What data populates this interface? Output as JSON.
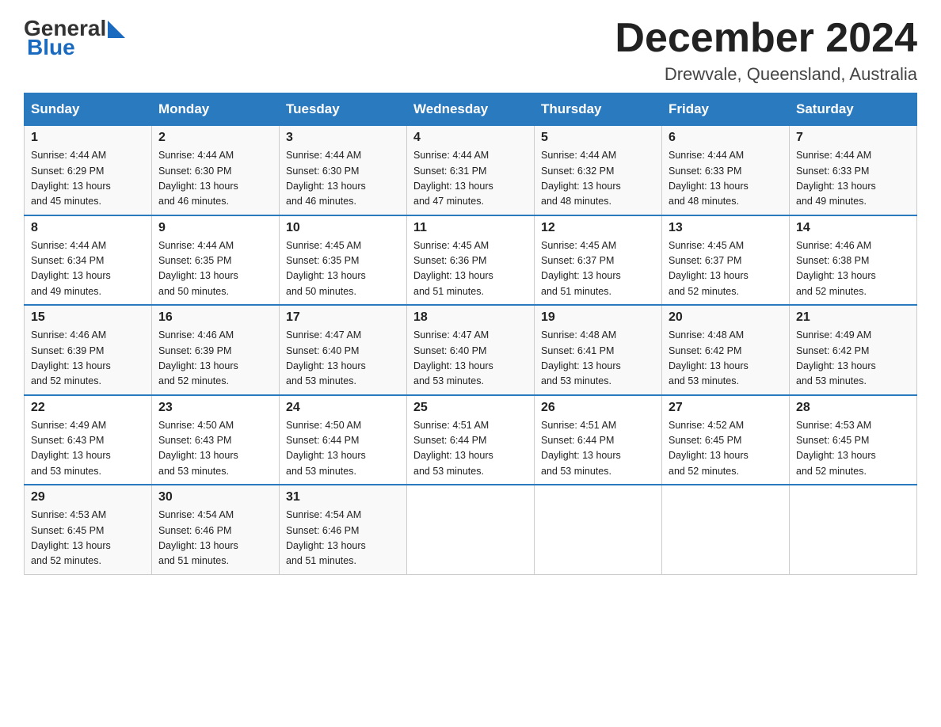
{
  "header": {
    "logo_general": "General",
    "logo_blue": "Blue",
    "month_title": "December 2024",
    "location": "Drewvale, Queensland, Australia"
  },
  "weekdays": [
    "Sunday",
    "Monday",
    "Tuesday",
    "Wednesday",
    "Thursday",
    "Friday",
    "Saturday"
  ],
  "weeks": [
    [
      {
        "day": "1",
        "sunrise": "4:44 AM",
        "sunset": "6:29 PM",
        "daylight": "13 hours and 45 minutes."
      },
      {
        "day": "2",
        "sunrise": "4:44 AM",
        "sunset": "6:30 PM",
        "daylight": "13 hours and 46 minutes."
      },
      {
        "day": "3",
        "sunrise": "4:44 AM",
        "sunset": "6:30 PM",
        "daylight": "13 hours and 46 minutes."
      },
      {
        "day": "4",
        "sunrise": "4:44 AM",
        "sunset": "6:31 PM",
        "daylight": "13 hours and 47 minutes."
      },
      {
        "day": "5",
        "sunrise": "4:44 AM",
        "sunset": "6:32 PM",
        "daylight": "13 hours and 48 minutes."
      },
      {
        "day": "6",
        "sunrise": "4:44 AM",
        "sunset": "6:33 PM",
        "daylight": "13 hours and 48 minutes."
      },
      {
        "day": "7",
        "sunrise": "4:44 AM",
        "sunset": "6:33 PM",
        "daylight": "13 hours and 49 minutes."
      }
    ],
    [
      {
        "day": "8",
        "sunrise": "4:44 AM",
        "sunset": "6:34 PM",
        "daylight": "13 hours and 49 minutes."
      },
      {
        "day": "9",
        "sunrise": "4:44 AM",
        "sunset": "6:35 PM",
        "daylight": "13 hours and 50 minutes."
      },
      {
        "day": "10",
        "sunrise": "4:45 AM",
        "sunset": "6:35 PM",
        "daylight": "13 hours and 50 minutes."
      },
      {
        "day": "11",
        "sunrise": "4:45 AM",
        "sunset": "6:36 PM",
        "daylight": "13 hours and 51 minutes."
      },
      {
        "day": "12",
        "sunrise": "4:45 AM",
        "sunset": "6:37 PM",
        "daylight": "13 hours and 51 minutes."
      },
      {
        "day": "13",
        "sunrise": "4:45 AM",
        "sunset": "6:37 PM",
        "daylight": "13 hours and 52 minutes."
      },
      {
        "day": "14",
        "sunrise": "4:46 AM",
        "sunset": "6:38 PM",
        "daylight": "13 hours and 52 minutes."
      }
    ],
    [
      {
        "day": "15",
        "sunrise": "4:46 AM",
        "sunset": "6:39 PM",
        "daylight": "13 hours and 52 minutes."
      },
      {
        "day": "16",
        "sunrise": "4:46 AM",
        "sunset": "6:39 PM",
        "daylight": "13 hours and 52 minutes."
      },
      {
        "day": "17",
        "sunrise": "4:47 AM",
        "sunset": "6:40 PM",
        "daylight": "13 hours and 53 minutes."
      },
      {
        "day": "18",
        "sunrise": "4:47 AM",
        "sunset": "6:40 PM",
        "daylight": "13 hours and 53 minutes."
      },
      {
        "day": "19",
        "sunrise": "4:48 AM",
        "sunset": "6:41 PM",
        "daylight": "13 hours and 53 minutes."
      },
      {
        "day": "20",
        "sunrise": "4:48 AM",
        "sunset": "6:42 PM",
        "daylight": "13 hours and 53 minutes."
      },
      {
        "day": "21",
        "sunrise": "4:49 AM",
        "sunset": "6:42 PM",
        "daylight": "13 hours and 53 minutes."
      }
    ],
    [
      {
        "day": "22",
        "sunrise": "4:49 AM",
        "sunset": "6:43 PM",
        "daylight": "13 hours and 53 minutes."
      },
      {
        "day": "23",
        "sunrise": "4:50 AM",
        "sunset": "6:43 PM",
        "daylight": "13 hours and 53 minutes."
      },
      {
        "day": "24",
        "sunrise": "4:50 AM",
        "sunset": "6:44 PM",
        "daylight": "13 hours and 53 minutes."
      },
      {
        "day": "25",
        "sunrise": "4:51 AM",
        "sunset": "6:44 PM",
        "daylight": "13 hours and 53 minutes."
      },
      {
        "day": "26",
        "sunrise": "4:51 AM",
        "sunset": "6:44 PM",
        "daylight": "13 hours and 53 minutes."
      },
      {
        "day": "27",
        "sunrise": "4:52 AM",
        "sunset": "6:45 PM",
        "daylight": "13 hours and 52 minutes."
      },
      {
        "day": "28",
        "sunrise": "4:53 AM",
        "sunset": "6:45 PM",
        "daylight": "13 hours and 52 minutes."
      }
    ],
    [
      {
        "day": "29",
        "sunrise": "4:53 AM",
        "sunset": "6:45 PM",
        "daylight": "13 hours and 52 minutes."
      },
      {
        "day": "30",
        "sunrise": "4:54 AM",
        "sunset": "6:46 PM",
        "daylight": "13 hours and 51 minutes."
      },
      {
        "day": "31",
        "sunrise": "4:54 AM",
        "sunset": "6:46 PM",
        "daylight": "13 hours and 51 minutes."
      },
      null,
      null,
      null,
      null
    ]
  ],
  "labels": {
    "sunrise": "Sunrise:",
    "sunset": "Sunset:",
    "daylight": "Daylight:"
  }
}
